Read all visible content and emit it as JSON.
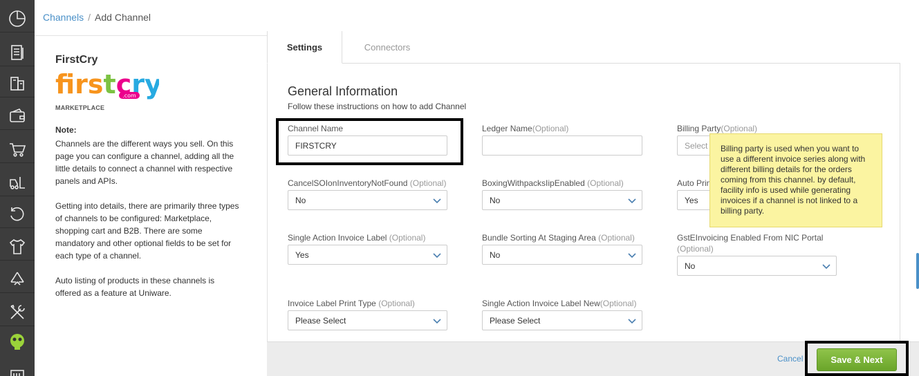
{
  "breadcrumb": {
    "parent": "Channels",
    "separator": "/",
    "current": "Add Channel"
  },
  "channel": {
    "name": "FirstCry",
    "type": "MARKETPLACE",
    "logo_text": "firstcry",
    "logo_domain": ".com"
  },
  "note": {
    "heading": "Note:",
    "p1": "Channels are the different ways you sell. On this page you can configure a channel, adding all the little details to connect a channel with respective panels and APIs.",
    "p2": "Getting into details, there are primarily three types of channels to be configured: Marketplace, shopping cart and B2B. There are some mandatory and other optional fields to be set for each type of a channel.",
    "p3": "Auto listing of products in these channels is offered as a feature at Uniware."
  },
  "tabs": {
    "settings": "Settings",
    "connectors": "Connectors"
  },
  "section": {
    "title": "General Information",
    "subtitle": "Follow these instructions on how to add Channel"
  },
  "fields": {
    "channel_name": {
      "label": "Channel Name",
      "value": "FIRSTCRY"
    },
    "ledger_name": {
      "label": "Ledger Name",
      "optional": "(Optional)",
      "value": ""
    },
    "billing_party": {
      "label": "Billing Party",
      "optional": "(Optional)",
      "placeholder": "Select"
    },
    "cancel_so": {
      "label": "CancelSOIonInventoryNotFound",
      "optional": "(Optional)",
      "value": "No"
    },
    "boxing": {
      "label": "BoxingWithpacksIipEnabled",
      "optional": "(Optional)",
      "value": "No"
    },
    "auto_print": {
      "label": "Auto Prin",
      "value": "Yes"
    },
    "single_action_label": {
      "label": "Single Action Invoice Label",
      "optional": "(Optional)",
      "value": "Yes"
    },
    "bundle_sorting": {
      "label": "Bundle Sorting At Staging Area",
      "optional": "(Optional)",
      "value": "No"
    },
    "gst_einvoicing": {
      "label": "GstEInvoicing Enabled From NIC Portal",
      "optional": "(Optional)",
      "value": "No"
    },
    "invoice_label_print": {
      "label": "Invoice Label Print Type",
      "optional": "(Optional)",
      "value": "Please Select"
    },
    "single_action_label_new": {
      "label": "Single Action Invoice Label New",
      "optional": "(Optional)",
      "value": "Please Select"
    }
  },
  "tooltip": "Billing party is used when you want to use a different invoice series along with different billing details for the orders coming from this channel. by default, facility info is used while generating invoices if a channel is not linked to a billing party.",
  "footer": {
    "cancel": "Cancel",
    "save": "Save & Next"
  },
  "sidebar_icons": [
    "dashboard-icon",
    "orders-icon",
    "shipping-icon",
    "wallet-icon",
    "cart-icon",
    "forklift-icon",
    "returns-icon",
    "apparel-icon",
    "recycle-icon",
    "tools-icon",
    "mascot-icon",
    "reports-icon"
  ],
  "colors": {
    "link": "#4a90c8",
    "save": "#7cb53a",
    "tooltip": "#fbf4a1",
    "rail": "#3d3d3d"
  }
}
